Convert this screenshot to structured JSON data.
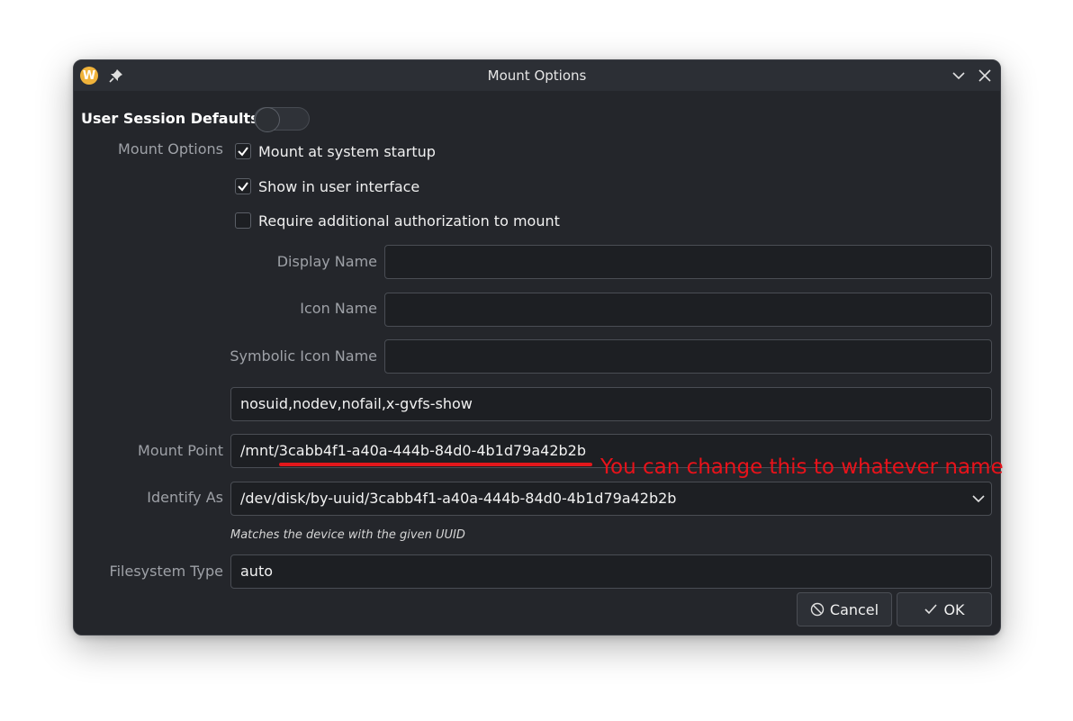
{
  "window": {
    "title": "Mount Options",
    "app_icon_letter": "W"
  },
  "user_session": {
    "label": "User Session Defaults",
    "enabled": false
  },
  "mount_options": {
    "label": "Mount Options",
    "checkboxes": [
      {
        "label": "Mount at system startup",
        "checked": true
      },
      {
        "label": "Show in user interface",
        "checked": true
      },
      {
        "label": "Require additional authorization to mount",
        "checked": false
      }
    ],
    "display_name": {
      "label": "Display Name",
      "value": ""
    },
    "icon_name": {
      "label": "Icon Name",
      "value": ""
    },
    "symbolic_icon_name": {
      "label": "Symbolic Icon Name",
      "value": ""
    },
    "options_string": "nosuid,nodev,nofail,x-gvfs-show"
  },
  "mount_point": {
    "label": "Mount Point",
    "value": "/mnt/3cabb4f1-a40a-444b-84d0-4b1d79a42b2b"
  },
  "identify_as": {
    "label": "Identify As",
    "value": "/dev/disk/by-uuid/3cabb4f1-a40a-444b-84d0-4b1d79a42b2b",
    "hint": "Matches the device with the given UUID"
  },
  "filesystem_type": {
    "label": "Filesystem Type",
    "value": "auto"
  },
  "buttons": {
    "cancel": "Cancel",
    "ok": "OK"
  },
  "annotation": {
    "text": "You can change this to whatever name",
    "color": "#e8121a"
  },
  "colors": {
    "background": "#24262b",
    "titlebar": "#2c2f35",
    "field": "#1d1f23",
    "accent": "#f0b33b"
  }
}
